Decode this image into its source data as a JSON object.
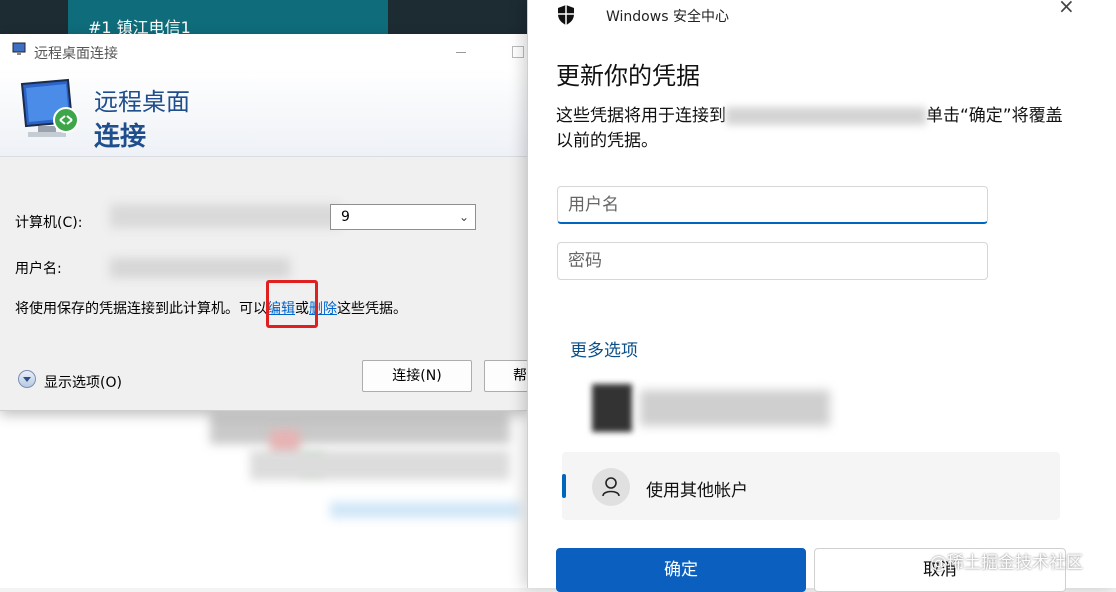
{
  "background": {
    "tab_title": "#1 镇江电信1"
  },
  "rdp": {
    "window_title": "远程桌面连接",
    "banner_line1": "远程桌面",
    "banner_line2": "连接",
    "computer_label": "计算机(C):",
    "computer_value_suffix": "9",
    "username_label": "用户名:",
    "saved_text_prefix": "将使用保存的凭据连接到此计算机。可以",
    "edit_link": "编辑",
    "or_text": "或",
    "delete_link": "删除",
    "saved_text_suffix": "这些凭据。",
    "show_options": "显示选项(O)",
    "connect_button": "连接(N)",
    "help_button": "帮"
  },
  "security": {
    "window_title": "Windows 安全中心",
    "heading": "更新你的凭据",
    "description_start": "这些凭据将用于连接到",
    "description_end": "单击“确定”将覆盖以前的凭据。",
    "username_placeholder": "用户名",
    "password_placeholder": "密码",
    "more_options": "更多选项",
    "other_account": "使用其他帐户",
    "ok_button": "确定",
    "cancel_button": "取消",
    "accent_color": "#0067c0"
  },
  "watermark": "@稀土掘金技术社区"
}
